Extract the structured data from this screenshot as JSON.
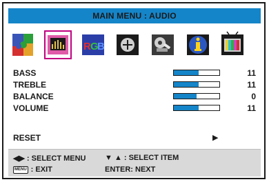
{
  "title": "MAIN MENU : AUDIO",
  "icons": [
    {
      "name": "picture-icon",
      "selected": false
    },
    {
      "name": "audio-icon",
      "selected": true
    },
    {
      "name": "rgb-icon",
      "label": "RGB",
      "selected": false
    },
    {
      "name": "position-icon",
      "selected": false
    },
    {
      "name": "setup-icon",
      "selected": false
    },
    {
      "name": "information-icon",
      "selected": false
    },
    {
      "name": "tv-icon",
      "selected": false
    }
  ],
  "settings": [
    {
      "label": "BASS",
      "value": "11",
      "level": 0.55
    },
    {
      "label": "TREBLE",
      "value": "11",
      "level": 0.55
    },
    {
      "label": "BALANCE",
      "value": "0",
      "level": 0.5
    },
    {
      "label": "VOLUME",
      "value": "11",
      "level": 0.55
    }
  ],
  "reset": {
    "label": "RESET",
    "arrow": "▶"
  },
  "help": {
    "select_menu": ": SELECT MENU",
    "select_item": ": SELECT ITEM",
    "exit": ": EXIT",
    "enter_next": "ENTER: NEXT",
    "menu_key": "MENU",
    "left_right_glyph": "◀▶",
    "down_up_glyph": "▼ ▲"
  },
  "colors": {
    "accent": "#1585c9",
    "selected_outline": "#c00080",
    "help_bg": "#d9d9d9"
  }
}
